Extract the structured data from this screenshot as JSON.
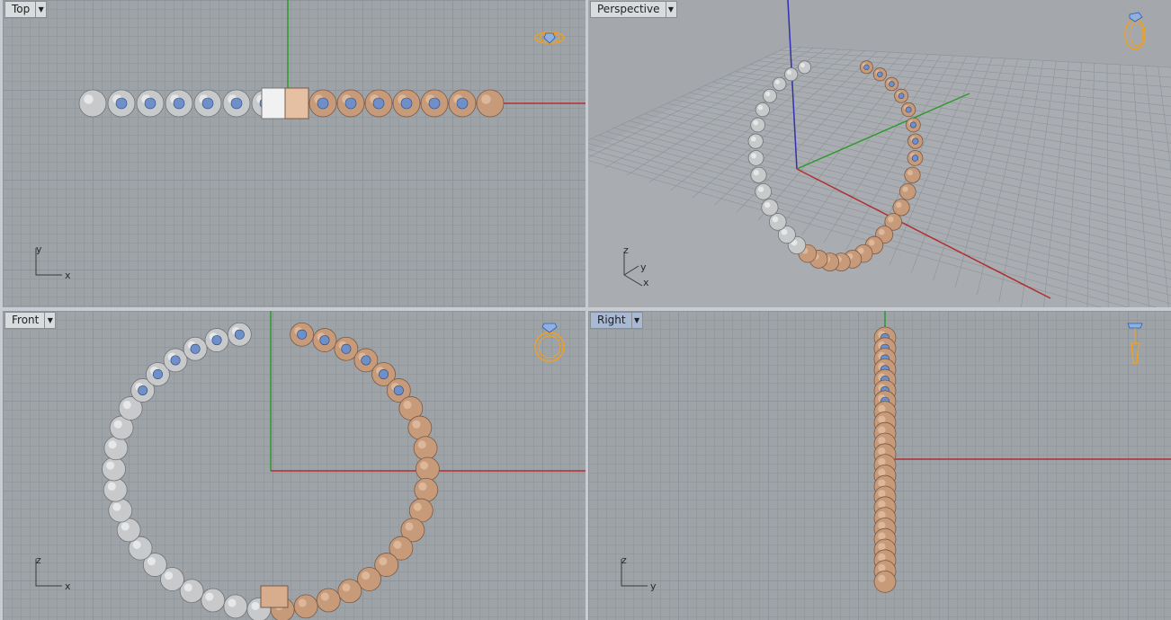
{
  "viewports": {
    "top": {
      "title": "Top",
      "axis_labels": [
        "y",
        "x"
      ]
    },
    "perspective": {
      "title": "Perspective",
      "axis_labels": [
        "z",
        "y",
        "x"
      ]
    },
    "front": {
      "title": "Front",
      "axis_labels": [
        "z",
        "x"
      ]
    },
    "right": {
      "title": "Right",
      "axis_labels": [
        "z",
        "y"
      ]
    }
  },
  "colors": {
    "grid_bg": "#9ea3a8",
    "silver": "#c7c9cb",
    "rose_gold": "#c79a7a",
    "gem": "#6f8fc8",
    "axis_x": "#b03030",
    "axis_y": "#2f9a2f",
    "axis_z": "#3030b0",
    "widget": "#f0a020",
    "active_tab": "#aab9d3"
  },
  "icons": {
    "viewport_dropdown": "chevron-down-icon",
    "nav_widget": "ring-widget-icon",
    "axis_triad": "axis-triad-icon"
  }
}
